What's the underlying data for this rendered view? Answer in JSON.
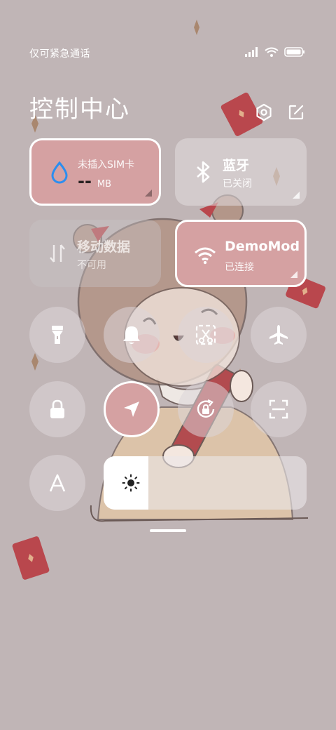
{
  "status_bar": {
    "carrier_text": "仅可紧急通话",
    "icons": [
      "signal-icon",
      "wifi-icon",
      "battery-icon"
    ]
  },
  "header": {
    "title": "控制中心",
    "buttons": [
      "settings-icon",
      "edit-icon"
    ]
  },
  "tiles": {
    "data_usage": {
      "label": "未插入SIM卡",
      "value": "--",
      "unit": "MB",
      "icon": "water-drop-icon"
    },
    "bluetooth": {
      "label": "蓝牙",
      "status": "已关闭",
      "icon": "bluetooth-icon"
    },
    "mobile_data": {
      "label": "移动数据",
      "status": "不可用",
      "icon": "mobile-data-icon"
    },
    "wifi": {
      "label": "DemoMod",
      "status": "已连接",
      "icon": "wifi-icon"
    }
  },
  "toggles": [
    {
      "name": "flashlight",
      "icon": "flashlight-icon",
      "active": false
    },
    {
      "name": "mute",
      "icon": "bell-icon",
      "active": false
    },
    {
      "name": "screenshot",
      "icon": "scissors-icon",
      "active": false
    },
    {
      "name": "airplane-mode",
      "icon": "airplane-icon",
      "active": false
    },
    {
      "name": "lock-screen",
      "icon": "lock-icon",
      "active": false
    },
    {
      "name": "location",
      "icon": "location-arrow-icon",
      "active": true
    },
    {
      "name": "rotation-lock",
      "icon": "rotation-lock-icon",
      "active": false
    },
    {
      "name": "scanner",
      "icon": "scan-icon",
      "active": false
    },
    {
      "name": "font-size",
      "icon": "font-a-icon",
      "active": false
    }
  ],
  "brightness": {
    "level": 0.22,
    "icon": "sun-icon"
  },
  "colors": {
    "background": "#c0b5b6",
    "active_tile": "#d5a1a2",
    "red_envelope": "#b8474c"
  }
}
